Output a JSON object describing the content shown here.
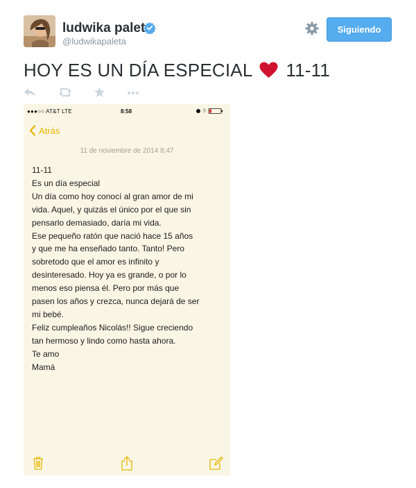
{
  "author": {
    "name": "ludwika paleta",
    "handle": "@ludwikapaleta"
  },
  "follow_button": {
    "label": "Siguiendo"
  },
  "tweet": {
    "text_before": "HOY ES UN DÍA ESPECIAL",
    "emoji": "heart-emoji",
    "text_after": "11-11"
  },
  "actions": [
    "reply-icon",
    "retweet-icon",
    "favorite-icon",
    "more-icon"
  ],
  "colors": {
    "accent": "#55acee",
    "heart": "#d0122f",
    "notes_accent": "#e6b500",
    "note_paper": "#faf6e6"
  },
  "note_screenshot": {
    "status_bar": {
      "carrier": "●●●○○ AT&T  LTE",
      "time": "8:58"
    },
    "back_label": "Atrás",
    "date": "11 de noviembre de 2014 8:47",
    "lines": [
      "11-11",
      "Es un día especial",
      "Un día como hoy conocí al gran amor de mi",
      "vida. Aquel, y quizás el único por el que sin",
      "pensarlo demasiado, daría mi vida.",
      "Ese pequeño ratón que nació hace 15 años",
      "y que me ha enseñado tanto. Tanto! Pero",
      "sobretodo que el amor es infinito y",
      "desinteresado. Hoy ya es grande, o por lo",
      "menos eso piensa él. Pero por más que",
      "pasen los años y crezca, nunca dejará de ser",
      "mi bebé.",
      "Feliz cumpleaños Nicolás!! Sigue creciendo",
      "tan hermoso y lindo como hasta ahora.",
      "Te amo",
      "Mamá"
    ],
    "toolbar": [
      "trash-icon",
      "share-icon",
      "compose-icon"
    ]
  }
}
